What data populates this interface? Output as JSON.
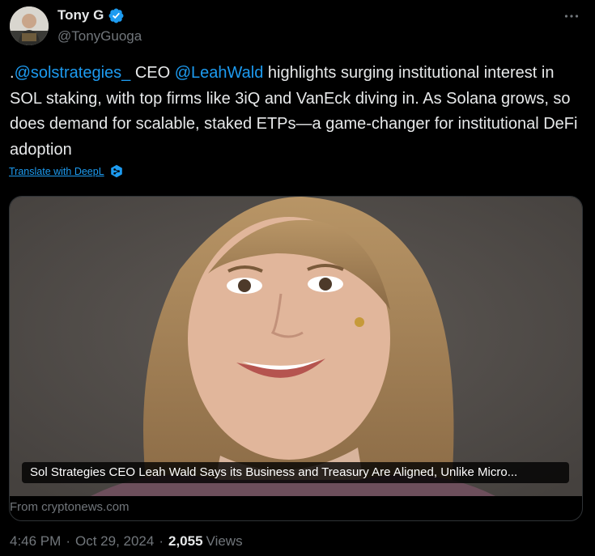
{
  "author": {
    "display_name": "Tony G",
    "handle": "@TonyGuoga",
    "verified_icon": "verified-badge-icon",
    "avatar_icon": "avatar"
  },
  "tweet": {
    "prefix": ".",
    "mention_1": "@solstrategies_",
    "text_1": " CEO ",
    "mention_2": "@LeahWald",
    "text_2": " highlights surging institutional interest in SOL staking, with top firms like 3iQ and VanEck diving in. As Solana grows, so does demand for scalable, staked ETPs—a game-changer for institutional DeFi adoption"
  },
  "translate": {
    "label": "Translate with DeepL",
    "icon": "deepl-icon"
  },
  "card": {
    "title": "Sol Strategies CEO Leah Wald Says its Business and Treasury Are Aligned, Unlike Micro...",
    "source": "From cryptonews.com"
  },
  "meta": {
    "time": "4:46 PM",
    "separator_1": "·",
    "date": "Oct 29, 2024",
    "separator_2": "·",
    "views_count": "2,055",
    "views_label": "Views"
  },
  "colors": {
    "background": "#000000",
    "text": "#e7e9ea",
    "secondary": "#71767b",
    "accent": "#1d9bf0"
  }
}
